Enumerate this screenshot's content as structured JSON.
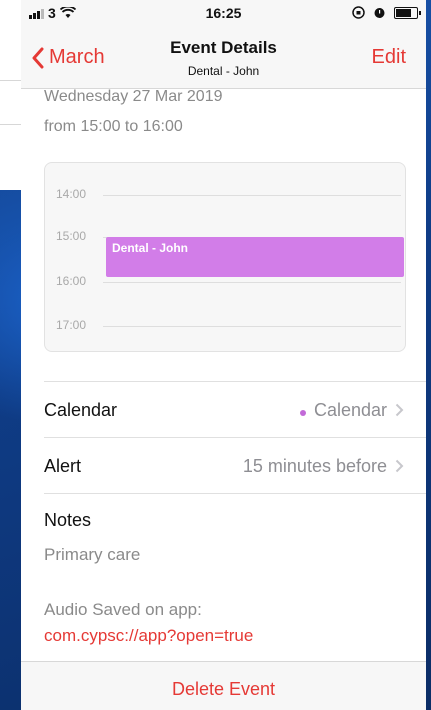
{
  "status": {
    "carrier": "3",
    "time": "16:25"
  },
  "nav": {
    "back_label": "March",
    "title": "Event Details",
    "subtitle": "Dental - John",
    "edit_label": "Edit"
  },
  "event": {
    "date": "Wednesday 27 Mar 2019",
    "time_range": "from 15:00 to 16:00",
    "block_title": "Dental - John",
    "block_color": "#d27de8"
  },
  "calendar_view": {
    "hours": [
      "14:00",
      "15:00",
      "16:00",
      "17:00"
    ]
  },
  "details": {
    "calendar_label": "Calendar",
    "calendar_value": "Calendar",
    "calendar_dot_color": "#c26ad8",
    "alert_label": "Alert",
    "alert_value": "15 minutes before"
  },
  "notes": {
    "heading": "Notes",
    "body": "Primary care",
    "audio_text": "Audio Saved on app:",
    "link": "com.cypsc://app?open=true"
  },
  "footer": {
    "delete_label": "Delete Event"
  },
  "colors": {
    "accent": "#e53935"
  }
}
